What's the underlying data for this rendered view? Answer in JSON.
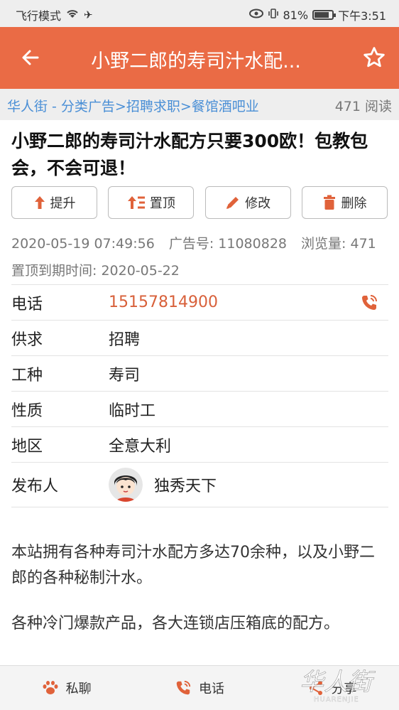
{
  "status_bar": {
    "left_text": "飞行模式",
    "battery": "81%",
    "battery_level": 0.81,
    "time": "下午3:51"
  },
  "app_bar": {
    "title": "小野二郎的寿司汁水配...",
    "accent_color": "#ea6b45"
  },
  "breadcrumb": {
    "path": "华人街 - 分类广告>招聘求职>餐馆酒吧业",
    "reads": "471 阅读"
  },
  "post": {
    "title": "小野二郎的寿司汁水配方只要300欧！包教包会，不会可退！",
    "actions": [
      "提升",
      "置顶",
      "修改",
      "删除"
    ],
    "date": "2020-05-19 07:49:56",
    "ad_no": "广告号: 11080828",
    "views": "浏览量: 471",
    "pin_expiry": "置顶到期时间: 2020-05-22"
  },
  "details": {
    "phone_label": "电话",
    "phone_value": "15157814900",
    "supply_label": "供求",
    "supply_value": "招聘",
    "job_label": "工种",
    "job_value": "寿司",
    "nature_label": "性质",
    "nature_value": "临时工",
    "region_label": "地区",
    "region_value": "全意大利",
    "publisher_label": "发布人",
    "publisher_value": "独秀天下"
  },
  "body": {
    "para1": "本站拥有各种寿司汁水配方多达70余种，以及小野二郎的各种秘制汁水。",
    "para2": "各种冷门爆款产品，各大连锁店压箱底的配方。"
  },
  "bottom_bar": {
    "chat": "私聊",
    "phone": "电话",
    "share": "分享"
  },
  "watermark": {
    "text": "华人街",
    "subtext": "HUARENJIE"
  }
}
